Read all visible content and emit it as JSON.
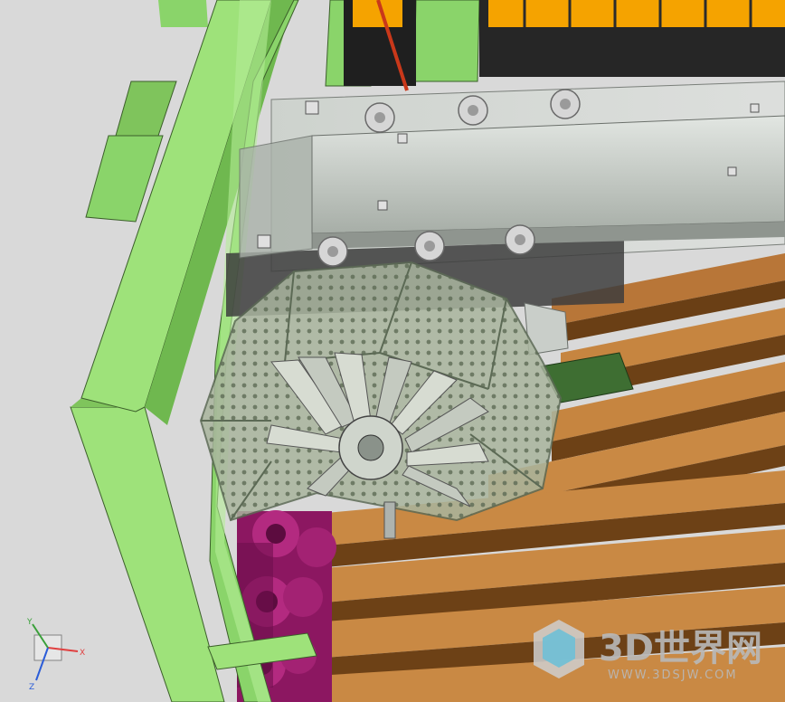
{
  "viewport": {
    "background_color": "#d8d8d8"
  },
  "axis_triad": {
    "x_label": "X",
    "y_label": "Y",
    "z_label": "Z",
    "x_color": "#e04040",
    "y_color": "#3aa03a",
    "z_color": "#2a5cd8"
  },
  "watermark": {
    "main_text": "3D世界网",
    "sub_text": "WWW.3DSJW.COM",
    "color": "#b9b9b9"
  },
  "model_colors": {
    "frame": "#9ee27a",
    "frame_dark": "#6fb84f",
    "wood_slat": "#c8833f",
    "wood_slat_dark": "#7a4a1c",
    "gearbox_cover": "#b9c2b9",
    "chain": "#a01d6f",
    "perforated_drum": "#b0b8a5",
    "pcb": "#3e6e32",
    "bin_yellow": "#f5a300"
  }
}
